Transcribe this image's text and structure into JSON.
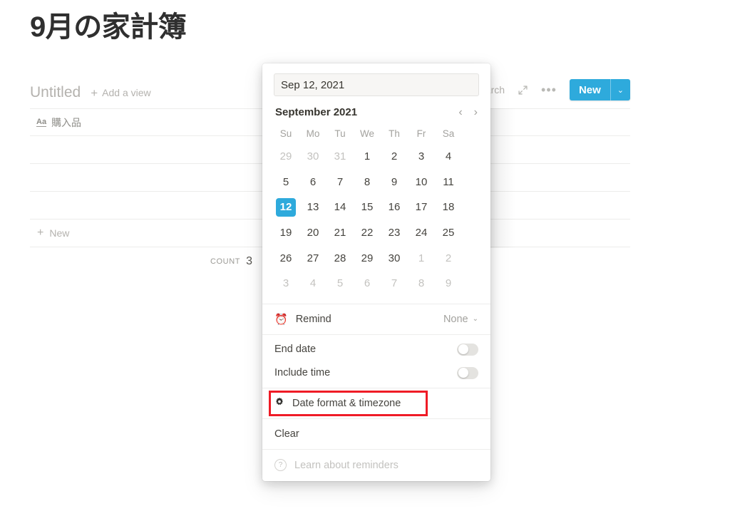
{
  "page": {
    "title": "9月の家計簿"
  },
  "view_bar": {
    "view_name": "Untitled",
    "add_view_label": "Add a view",
    "add_view_icon": "plus-icon"
  },
  "toolbar": {
    "search_label": "arch",
    "search_full_label": "Search",
    "expand_icon": "expand-arrows-icon",
    "more_icon": "ellipsis-icon",
    "new_label": "New",
    "new_caret": "⌄",
    "accent_color": "#2eaadc"
  },
  "table": {
    "columns": [
      {
        "icon": "text-type-icon",
        "icon_label": "Aa",
        "label": "購入品"
      }
    ],
    "rows": [
      {
        "購入品": ""
      },
      {
        "購入品": ""
      },
      {
        "購入品": ""
      }
    ],
    "new_row_label": "New",
    "new_row_icon": "plus-icon",
    "footer": {
      "count_label": "COUNT",
      "count_value": "3"
    }
  },
  "date_popup": {
    "input": {
      "value": "Sep 12, 2021",
      "placeholder": "Sep 12, 2021"
    },
    "calendar": {
      "month_label": "September 2021",
      "prev_icon": "chevron-left-icon",
      "next_icon": "chevron-right-icon",
      "prev_glyph": "‹",
      "next_glyph": "›",
      "weekdays": [
        "Su",
        "Mo",
        "Tu",
        "We",
        "Th",
        "Fr",
        "Sa"
      ],
      "selected_day": 12,
      "selected_color": "#2eaadc",
      "weeks": [
        [
          {
            "d": "29",
            "muted": true
          },
          {
            "d": "30",
            "muted": true
          },
          {
            "d": "31",
            "muted": true
          },
          {
            "d": "1",
            "muted": false
          },
          {
            "d": "2",
            "muted": false
          },
          {
            "d": "3",
            "muted": false
          },
          {
            "d": "4",
            "muted": false
          }
        ],
        [
          {
            "d": "5",
            "muted": false
          },
          {
            "d": "6",
            "muted": false
          },
          {
            "d": "7",
            "muted": false
          },
          {
            "d": "8",
            "muted": false
          },
          {
            "d": "9",
            "muted": false
          },
          {
            "d": "10",
            "muted": false
          },
          {
            "d": "11",
            "muted": false
          }
        ],
        [
          {
            "d": "12",
            "muted": false,
            "selected": true
          },
          {
            "d": "13",
            "muted": false
          },
          {
            "d": "14",
            "muted": false
          },
          {
            "d": "15",
            "muted": false
          },
          {
            "d": "16",
            "muted": false
          },
          {
            "d": "17",
            "muted": false
          },
          {
            "d": "18",
            "muted": false
          }
        ],
        [
          {
            "d": "19",
            "muted": false
          },
          {
            "d": "20",
            "muted": false
          },
          {
            "d": "21",
            "muted": false
          },
          {
            "d": "22",
            "muted": false
          },
          {
            "d": "23",
            "muted": false
          },
          {
            "d": "24",
            "muted": false
          },
          {
            "d": "25",
            "muted": false
          }
        ],
        [
          {
            "d": "26",
            "muted": false
          },
          {
            "d": "27",
            "muted": false
          },
          {
            "d": "28",
            "muted": false
          },
          {
            "d": "29",
            "muted": false
          },
          {
            "d": "30",
            "muted": false
          },
          {
            "d": "1",
            "muted": true
          },
          {
            "d": "2",
            "muted": true
          }
        ],
        [
          {
            "d": "3",
            "muted": true
          },
          {
            "d": "4",
            "muted": true
          },
          {
            "d": "5",
            "muted": true
          },
          {
            "d": "6",
            "muted": true
          },
          {
            "d": "7",
            "muted": true
          },
          {
            "d": "8",
            "muted": true
          },
          {
            "d": "9",
            "muted": true
          }
        ]
      ]
    },
    "remind": {
      "icon": "alarm-clock-icon",
      "icon_glyph": "⏰",
      "label": "Remind",
      "value": "None",
      "caret": "⌄"
    },
    "end_date": {
      "label": "End date",
      "enabled": false
    },
    "include_time": {
      "label": "Include time",
      "enabled": false
    },
    "date_format_timezone": {
      "icon": "gear-icon",
      "icon_glyph": "✿",
      "label": "Date format & timezone",
      "highlight_color": "#ef1b26"
    },
    "clear": {
      "label": "Clear"
    },
    "learn": {
      "icon": "question-circle-icon",
      "icon_glyph": "?",
      "label": "Learn about reminders"
    }
  }
}
